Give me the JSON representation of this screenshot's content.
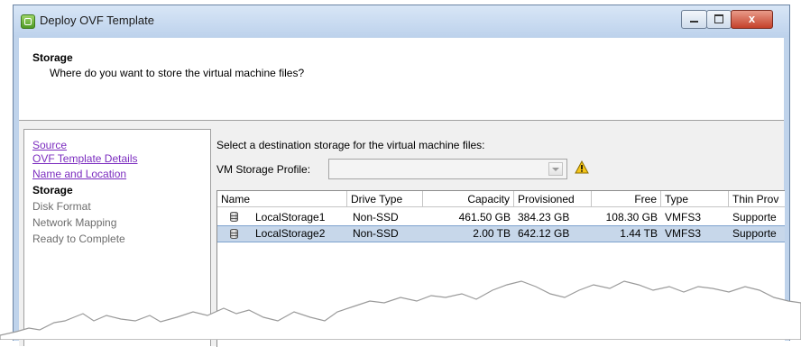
{
  "window": {
    "title": "Deploy OVF Template",
    "close_glyph": "x"
  },
  "header": {
    "title": "Storage",
    "subtitle": "Where do you want to store the virtual machine files?"
  },
  "nav": {
    "items": [
      {
        "label": "Source",
        "state": "link"
      },
      {
        "label": "OVF Template Details",
        "state": "link"
      },
      {
        "label": "Name and Location",
        "state": "link"
      },
      {
        "label": "Storage",
        "state": "current"
      },
      {
        "label": "Disk Format",
        "state": "pending"
      },
      {
        "label": "Network Mapping",
        "state": "pending"
      },
      {
        "label": "Ready to Complete",
        "state": "pending"
      }
    ]
  },
  "main": {
    "instruction": "Select a destination storage for the virtual machine files:",
    "profile_label": "VM Storage Profile:",
    "profile_value": "",
    "warning_icon": "warning-icon"
  },
  "table": {
    "columns": [
      "Name",
      "Drive Type",
      "Capacity",
      "Provisioned",
      "Free",
      "Type",
      "Thin Prov"
    ],
    "rows": [
      {
        "name": "LocalStorage1",
        "drive": "Non-SSD",
        "capacity": "461.50 GB",
        "provisioned": "384.23 GB",
        "free": "108.30 GB",
        "type": "VMFS3",
        "thin": "Supporte",
        "selected": false
      },
      {
        "name": "LocalStorage2",
        "drive": "Non-SSD",
        "capacity": "2.00 TB",
        "provisioned": "642.12 GB",
        "free": "1.44 TB",
        "type": "VMFS3",
        "thin": "Supporte",
        "selected": true
      }
    ]
  },
  "colors": {
    "link": "#7b2cbf",
    "selected_row": "#c7d7ea",
    "title_bar": "#bfd3eb",
    "warning": "#f5c518"
  }
}
